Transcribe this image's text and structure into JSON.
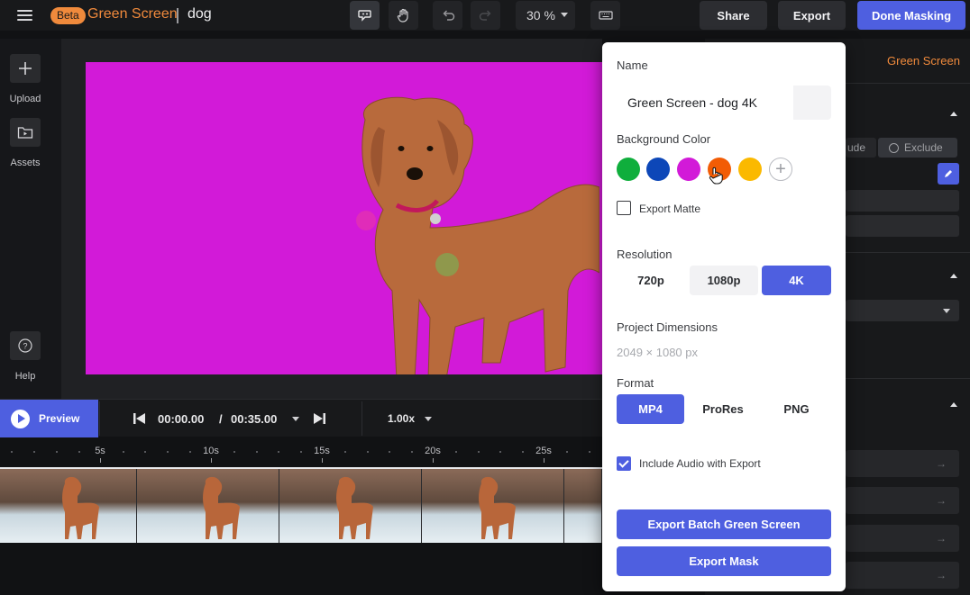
{
  "header": {
    "beta_badge": "Beta",
    "app_title": "Green Screen",
    "project_name": "dog",
    "zoom": "30 %",
    "share_label": "Share",
    "export_label": "Export",
    "done_label": "Done Masking"
  },
  "left_rail": {
    "upload_label": "Upload",
    "assets_label": "Assets",
    "help_label": "Help"
  },
  "canvas": {
    "background_color": "#d21ad8"
  },
  "playback": {
    "preview_label": "Preview",
    "current_time": "00:00.00",
    "separator": "/",
    "duration": "00:35.00",
    "speed": "1.00x"
  },
  "ruler": {
    "ticks": [
      "5s",
      "10s",
      "15s",
      "20s",
      "25s"
    ]
  },
  "right_panel": {
    "tab_label": "Green Screen",
    "include_partial": "ude",
    "exclude_label": "Exclude"
  },
  "dialog": {
    "name_label": "Name",
    "name_value": "Green Screen - dog 4K",
    "bg_color_label": "Background Color",
    "colors": [
      "#0fae3c",
      "#0d47b8",
      "#d21ad8",
      "#f25c05",
      "#fbb900"
    ],
    "export_matte_label": "Export Matte",
    "export_matte_checked": false,
    "resolution_label": "Resolution",
    "resolutions": [
      "720p",
      "1080p",
      "4K"
    ],
    "resolution_selected": "4K",
    "dimensions_label": "Project Dimensions",
    "dimensions_value": "2049 × 1080 px",
    "format_label": "Format",
    "formats": [
      "MP4",
      "ProRes",
      "PNG"
    ],
    "format_selected": "MP4",
    "include_audio_label": "Include Audio with Export",
    "include_audio_checked": true,
    "export_batch_label": "Export Batch Green Screen",
    "export_mask_label": "Export Mask"
  }
}
